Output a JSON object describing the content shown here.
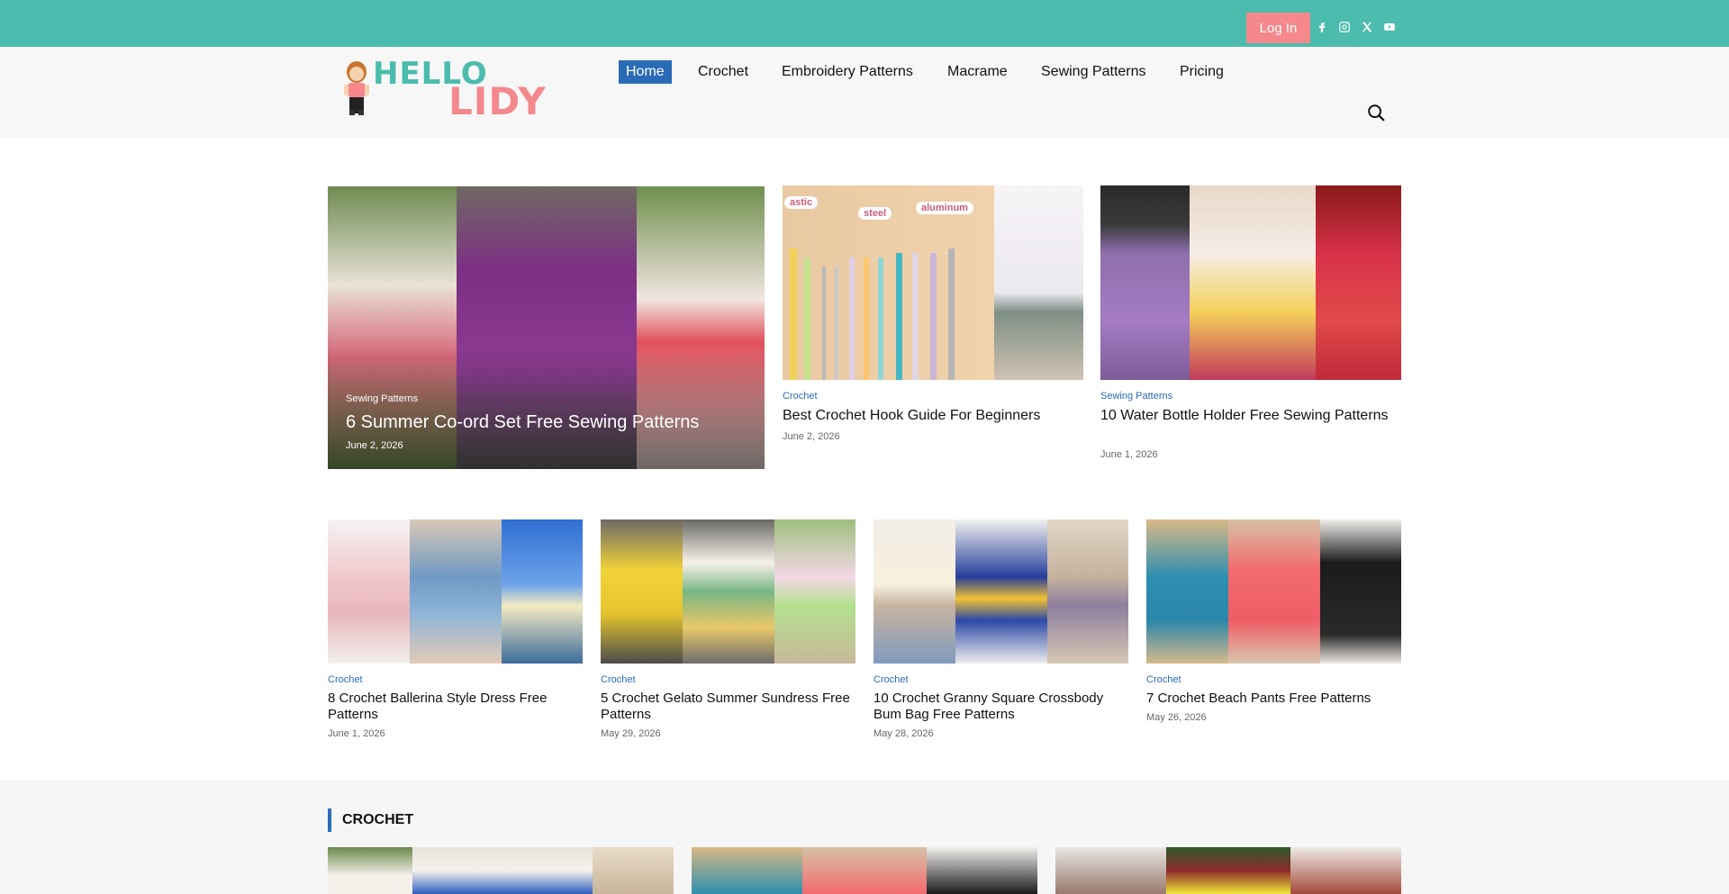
{
  "topbar": {
    "login_label": "Log In",
    "social_icons": [
      "facebook-icon",
      "instagram-icon",
      "x-icon",
      "youtube-icon"
    ]
  },
  "logo": {
    "line1": "HELLO",
    "line2": "LIDY"
  },
  "nav": {
    "items": [
      {
        "label": "Home",
        "active": true
      },
      {
        "label": "Crochet"
      },
      {
        "label": "Embroidery Patterns"
      },
      {
        "label": "Macrame"
      },
      {
        "label": "Sewing Patterns"
      },
      {
        "label": "Pricing"
      }
    ]
  },
  "featured": {
    "main": {
      "category": "Sewing Patterns",
      "title": "6 Summer Co-ord Set Free Sewing Patterns",
      "date": "June 2, 2026"
    },
    "side": [
      {
        "category": "Crochet",
        "title": "Best Crochet Hook Guide For Beginners",
        "date": "June 2, 2026",
        "image_labels": [
          "astic",
          "steel",
          "aluminum"
        ]
      },
      {
        "category": "Sewing Patterns",
        "title": "10 Water Bottle Holder Free Sewing Patterns",
        "date": "June 1, 2026"
      }
    ]
  },
  "grid": [
    {
      "category": "Crochet",
      "title": "8 Crochet Ballerina Style Dress Free Patterns",
      "date": "June 1, 2026"
    },
    {
      "category": "Crochet",
      "title": "5 Crochet Gelato Summer Sundress Free Patterns",
      "date": "May 29, 2026"
    },
    {
      "category": "Crochet",
      "title": "10 Crochet Granny Square Crossbody Bum Bag Free Patterns",
      "date": "May 28, 2026"
    },
    {
      "category": "Crochet",
      "title": "7 Crochet Beach Pants Free Patterns",
      "date": "May 26, 2026"
    }
  ],
  "section": {
    "title": "CROCHET"
  },
  "colors": {
    "teal": "#4bbcad",
    "pink": "#f4888c",
    "accent_blue": "#2a6bb8"
  }
}
